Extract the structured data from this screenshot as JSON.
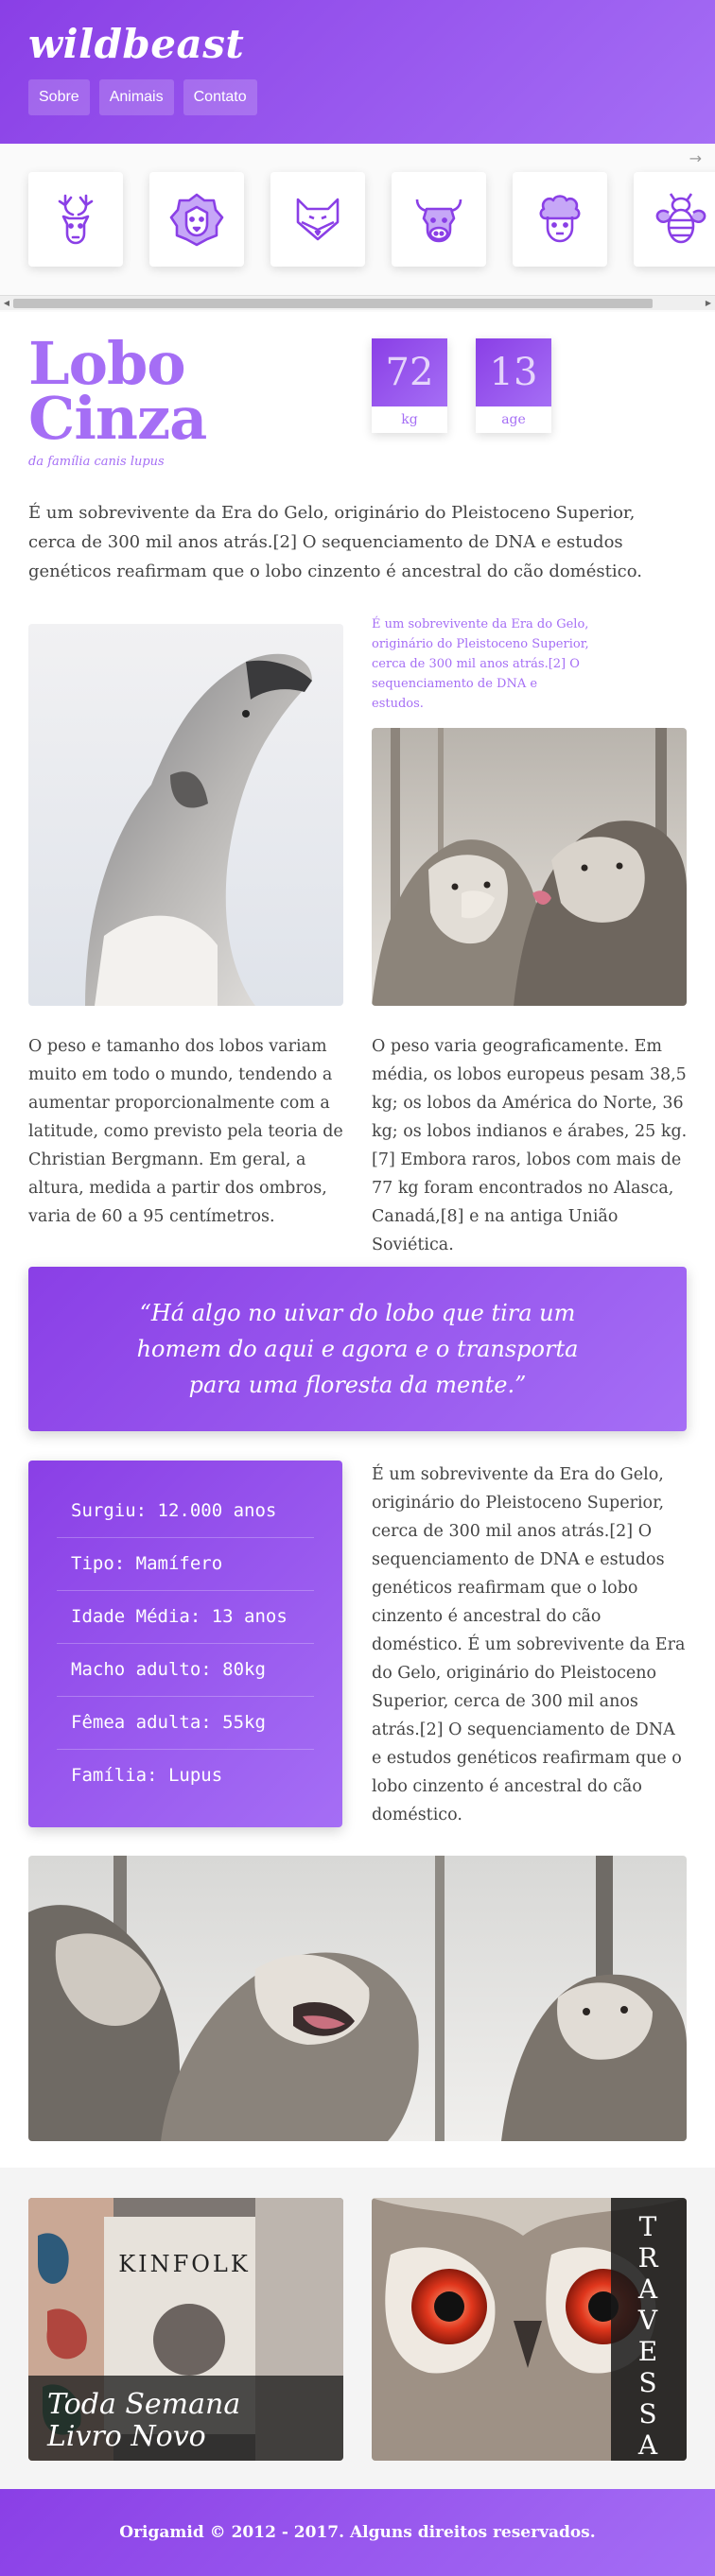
{
  "header": {
    "logo": "wildbeast",
    "menu": [
      "Sobre",
      "Animais",
      "Contato"
    ]
  },
  "animals_strip": {
    "arrow": "→",
    "icons": [
      "deer-icon",
      "lion-icon",
      "fox-icon",
      "bull-icon",
      "sheep-icon",
      "bee-icon"
    ]
  },
  "animal": {
    "title_line1": "Lobo",
    "title_line2": "Cinza",
    "subtitle": "da família canis lupus",
    "stats": [
      {
        "value": "72",
        "unit": "kg"
      },
      {
        "value": "13",
        "unit": "age"
      }
    ],
    "intro": "É um sobrevivente da Era do Gelo, originário do Pleistoceno Superior, cerca de 300 mil anos atrás.[2] O sequenciamento de DNA e estudos genéticos reafirmam que o lobo cinzento é ancestral do cão doméstico.",
    "caption": "É um sobrevivente da Era do Gelo, originário do Pleistoceno Superior, cerca de 300 mil anos atrás.[2] O sequenciamento de DNA e estudos.",
    "col_left": "O peso e tamanho dos lobos variam muito em todo o mundo, tendendo a aumentar proporcionalmente com a latitude, como previsto pela teoria de Christian Bergmann. Em geral, a altura, medida a partir dos ombros, varia de 60 a 95 centímetros.",
    "col_right": "O peso varia geograficamente. Em média, os lobos europeus pesam 38,5 kg; os lobos da América do Norte, 36 kg; os lobos indianos e árabes, 25 kg.[7] Embora raros, lobos com mais de 77 kg foram encontrados no Alasca, Canadá,[8] e na antiga União Soviética.",
    "quote": "“Há algo no uivar do lobo que tira um homem do aqui e agora e o transporta para uma floresta da mente.”",
    "facts": [
      "Surgiu: 12.000 anos",
      "Tipo: Mamífero",
      "Idade Média: 13 anos",
      "Macho adulto: 80kg",
      "Fêmea adulta: 55kg",
      "Família: Lupus"
    ],
    "facts_text": "É um sobrevivente da Era do Gelo, originário do Pleistoceno Superior, cerca de 300 mil anos atrás.[2] O sequenciamento de DNA e estudos genéticos reafirmam que o lobo cinzento é ancestral do cão doméstico. É um sobrevivente da Era do Gelo, originário do Pleistoceno Superior, cerca de 300 mil anos atrás.[2] O sequenciamento de DNA e estudos genéticos reafirmam que o lobo cinzento é ancestral do cão doméstico."
  },
  "tiles": {
    "book_cover_text": "KINFOLK",
    "book_label_line1": "Toda Semana",
    "book_label_line2": "Livro Novo",
    "vertical_label": [
      "T",
      "R",
      "A",
      "V",
      "E",
      "S",
      "S",
      "A"
    ]
  },
  "footer": {
    "text": "Origamid © 2012 - 2017. Alguns direitos reservados."
  },
  "colors": {
    "accent": "#a56ef5",
    "accent_dark": "#8a3fe6"
  }
}
